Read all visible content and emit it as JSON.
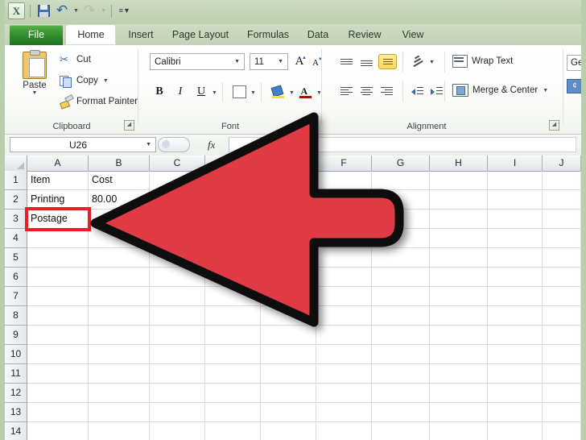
{
  "app": {
    "name": "Microsoft Excel 2010",
    "logo_text": "X"
  },
  "quick_access": {
    "items": [
      {
        "name": "save",
        "label": "Save",
        "icon": "floppy-disk-icon"
      },
      {
        "name": "undo",
        "label": "Undo",
        "icon": "undo-arrow-icon"
      },
      {
        "name": "redo",
        "label": "Redo",
        "icon": "redo-arrow-icon"
      },
      {
        "name": "customize",
        "label": "Customize Quick Access Toolbar",
        "icon": "chevron-down-icon"
      }
    ]
  },
  "ribbon": {
    "tabs": [
      {
        "label": "File",
        "active": false,
        "is_file": true
      },
      {
        "label": "Home",
        "active": true,
        "is_file": false
      },
      {
        "label": "Insert",
        "active": false,
        "is_file": false
      },
      {
        "label": "Page Layout",
        "active": false,
        "is_file": false
      },
      {
        "label": "Formulas",
        "active": false,
        "is_file": false
      },
      {
        "label": "Data",
        "active": false,
        "is_file": false
      },
      {
        "label": "Review",
        "active": false,
        "is_file": false
      },
      {
        "label": "View",
        "active": false,
        "is_file": false
      }
    ],
    "groups": {
      "clipboard": {
        "label": "Clipboard",
        "paste": "Paste",
        "cut": "Cut",
        "copy": "Copy",
        "format_painter": "Format Painter"
      },
      "font": {
        "label": "Font",
        "font_name": "Calibri",
        "font_size": "11",
        "grow_font": "A",
        "shrink_font": "A",
        "bold": "B",
        "italic": "I",
        "underline": "U"
      },
      "alignment": {
        "label": "Alignment",
        "wrap_text": "Wrap Text",
        "merge_center": "Merge & Center"
      },
      "number": {
        "format_value": "Ge"
      }
    }
  },
  "formula_bar": {
    "name_box": "U26",
    "fx_label": "fx",
    "formula_value": ""
  },
  "sheet": {
    "columns": [
      "A",
      "B",
      "C",
      "D",
      "E",
      "F",
      "G",
      "H",
      "I",
      "J"
    ],
    "rows": [
      "1",
      "2",
      "3",
      "4",
      "5",
      "6",
      "7",
      "8",
      "9",
      "10",
      "11",
      "12",
      "13",
      "14"
    ],
    "cells": [
      {
        "col": 0,
        "row": 0,
        "value": "Item"
      },
      {
        "col": 1,
        "row": 0,
        "value": "Cost"
      },
      {
        "col": 0,
        "row": 1,
        "value": "Printing"
      },
      {
        "col": 1,
        "row": 1,
        "value": "80.00"
      },
      {
        "col": 0,
        "row": 2,
        "value": "Postage"
      }
    ],
    "highlight": {
      "col": 0,
      "row": 2,
      "color": "#ee1c25"
    }
  },
  "annotation": {
    "arrow": {
      "name": "red-pointer-arrow",
      "direction": "left",
      "fill": "#e03a45",
      "outline": "#0d0d0d",
      "points_to": "A3"
    }
  },
  "colors": {
    "window_chrome": "#b9ceac",
    "file_tab_green": "#2f8a2c",
    "highlight_red": "#ee1c25",
    "arrow_red": "#e03a45"
  }
}
